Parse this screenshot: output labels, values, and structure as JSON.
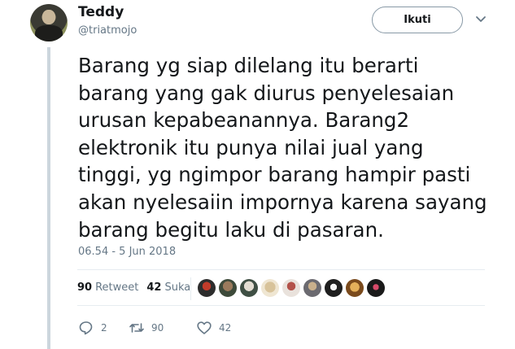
{
  "user": {
    "name": "Teddy",
    "handle": "@triatmojo"
  },
  "follow_label": "Ikuti",
  "tweet": {
    "lines": [
      "Barang yg siap dilelang itu berarti",
      "barang yang gak diurus penyelesaian",
      "urusan kepabeanannya. Barang2",
      "elektronik itu punya nilai jual yang",
      "tinggi, yg ngimpor barang hampir pasti",
      "akan nyelesaiin impornya karena sayang",
      "barang begitu laku di pasaran."
    ],
    "timestamp": "06.54 - 5 Jun 2018"
  },
  "stats": {
    "retweets_count": "90",
    "retweets_label": "Retweet",
    "likes_count": "42",
    "likes_label": "Suka"
  },
  "actions": {
    "reply_count": "2",
    "retweet_count": "90",
    "like_count": "42"
  },
  "colors": {
    "text": "#14171a",
    "muted": "#657786",
    "border": "#e6ecf0",
    "thread": "#ccd6dd"
  }
}
